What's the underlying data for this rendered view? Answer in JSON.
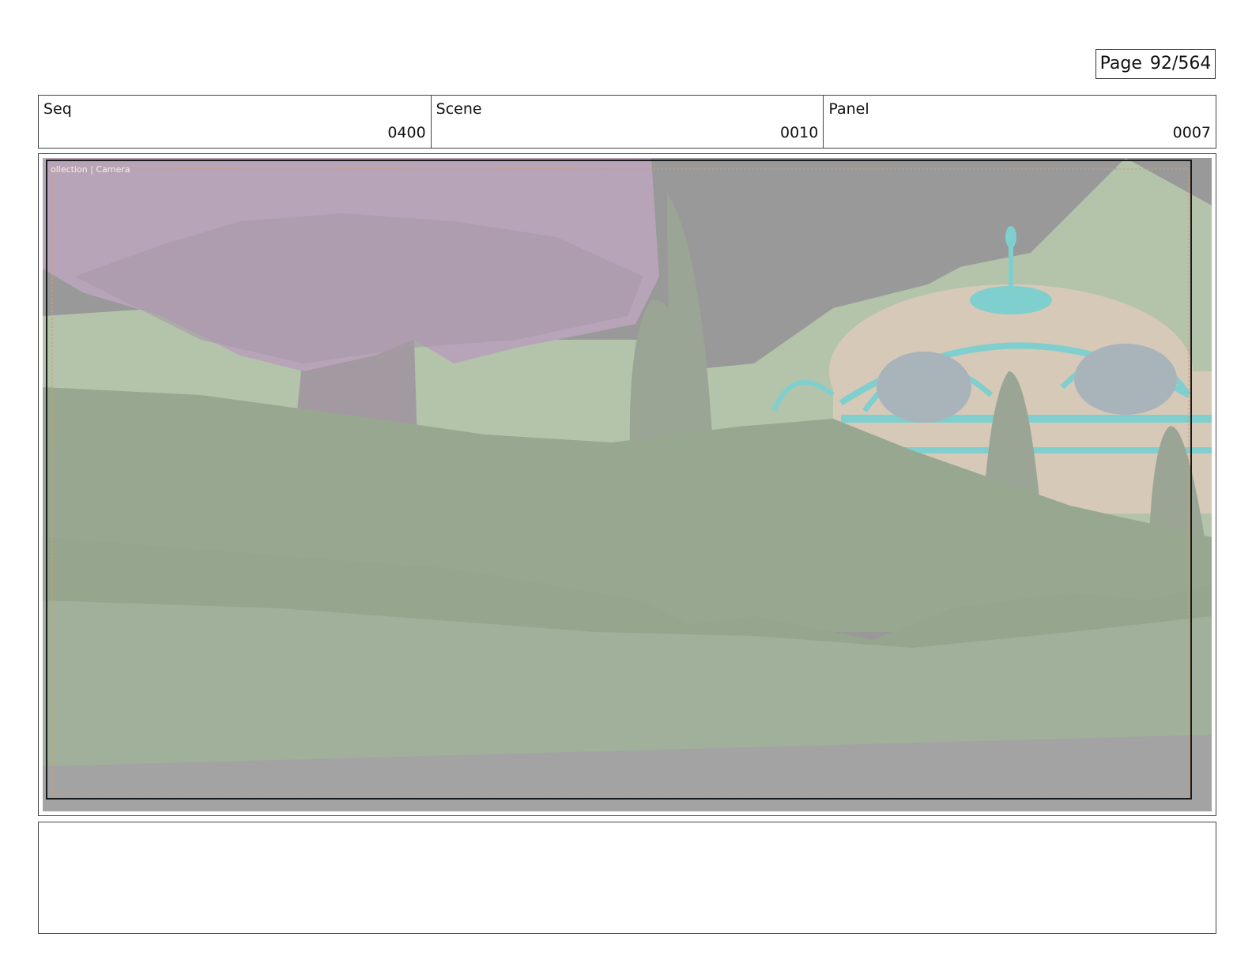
{
  "page": {
    "label": "Page",
    "number": "92/564"
  },
  "shot_info": {
    "seq": {
      "label": "Seq",
      "value": "0400"
    },
    "scene": {
      "label": "Scene",
      "value": "0010"
    },
    "panel": {
      "label": "Panel",
      "value": "0007"
    }
  },
  "frame": {
    "viewport_label": "ollection | Camera",
    "palette": {
      "sky": "#999999",
      "hill": "#b3c4ab",
      "ground": "#98a890",
      "foliage": "#b8a4b8",
      "trunk": "#a29aa0",
      "cypress": "#9aa595",
      "dome": "#d6c9b8",
      "metalwork": "#7fcfcf",
      "floor": "#a3a3a3"
    }
  },
  "notes": {
    "text": ""
  }
}
